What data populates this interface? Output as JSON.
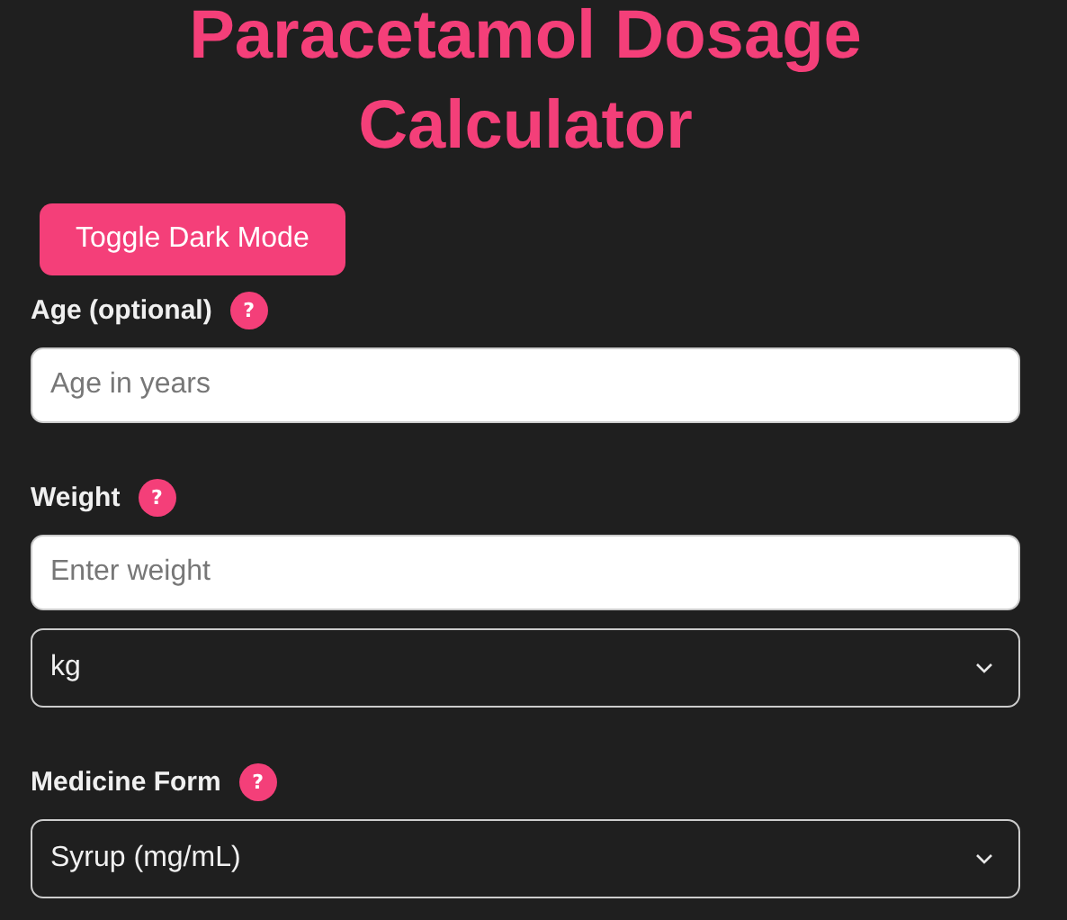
{
  "title": "Paracetamol Dosage Calculator",
  "toggle_button": "Toggle Dark Mode",
  "fields": [
    {
      "label": "Age (optional)",
      "help": "?",
      "controls": [
        {
          "kind": "input",
          "placeholder": "Age in years"
        }
      ]
    },
    {
      "label": "Weight",
      "help": "?",
      "controls": [
        {
          "kind": "input",
          "placeholder": "Enter weight"
        },
        {
          "kind": "select",
          "value": "kg"
        }
      ]
    },
    {
      "label": "Medicine Form",
      "help": "?",
      "controls": [
        {
          "kind": "select",
          "value": "Syrup (mg/mL)"
        }
      ]
    }
  ]
}
